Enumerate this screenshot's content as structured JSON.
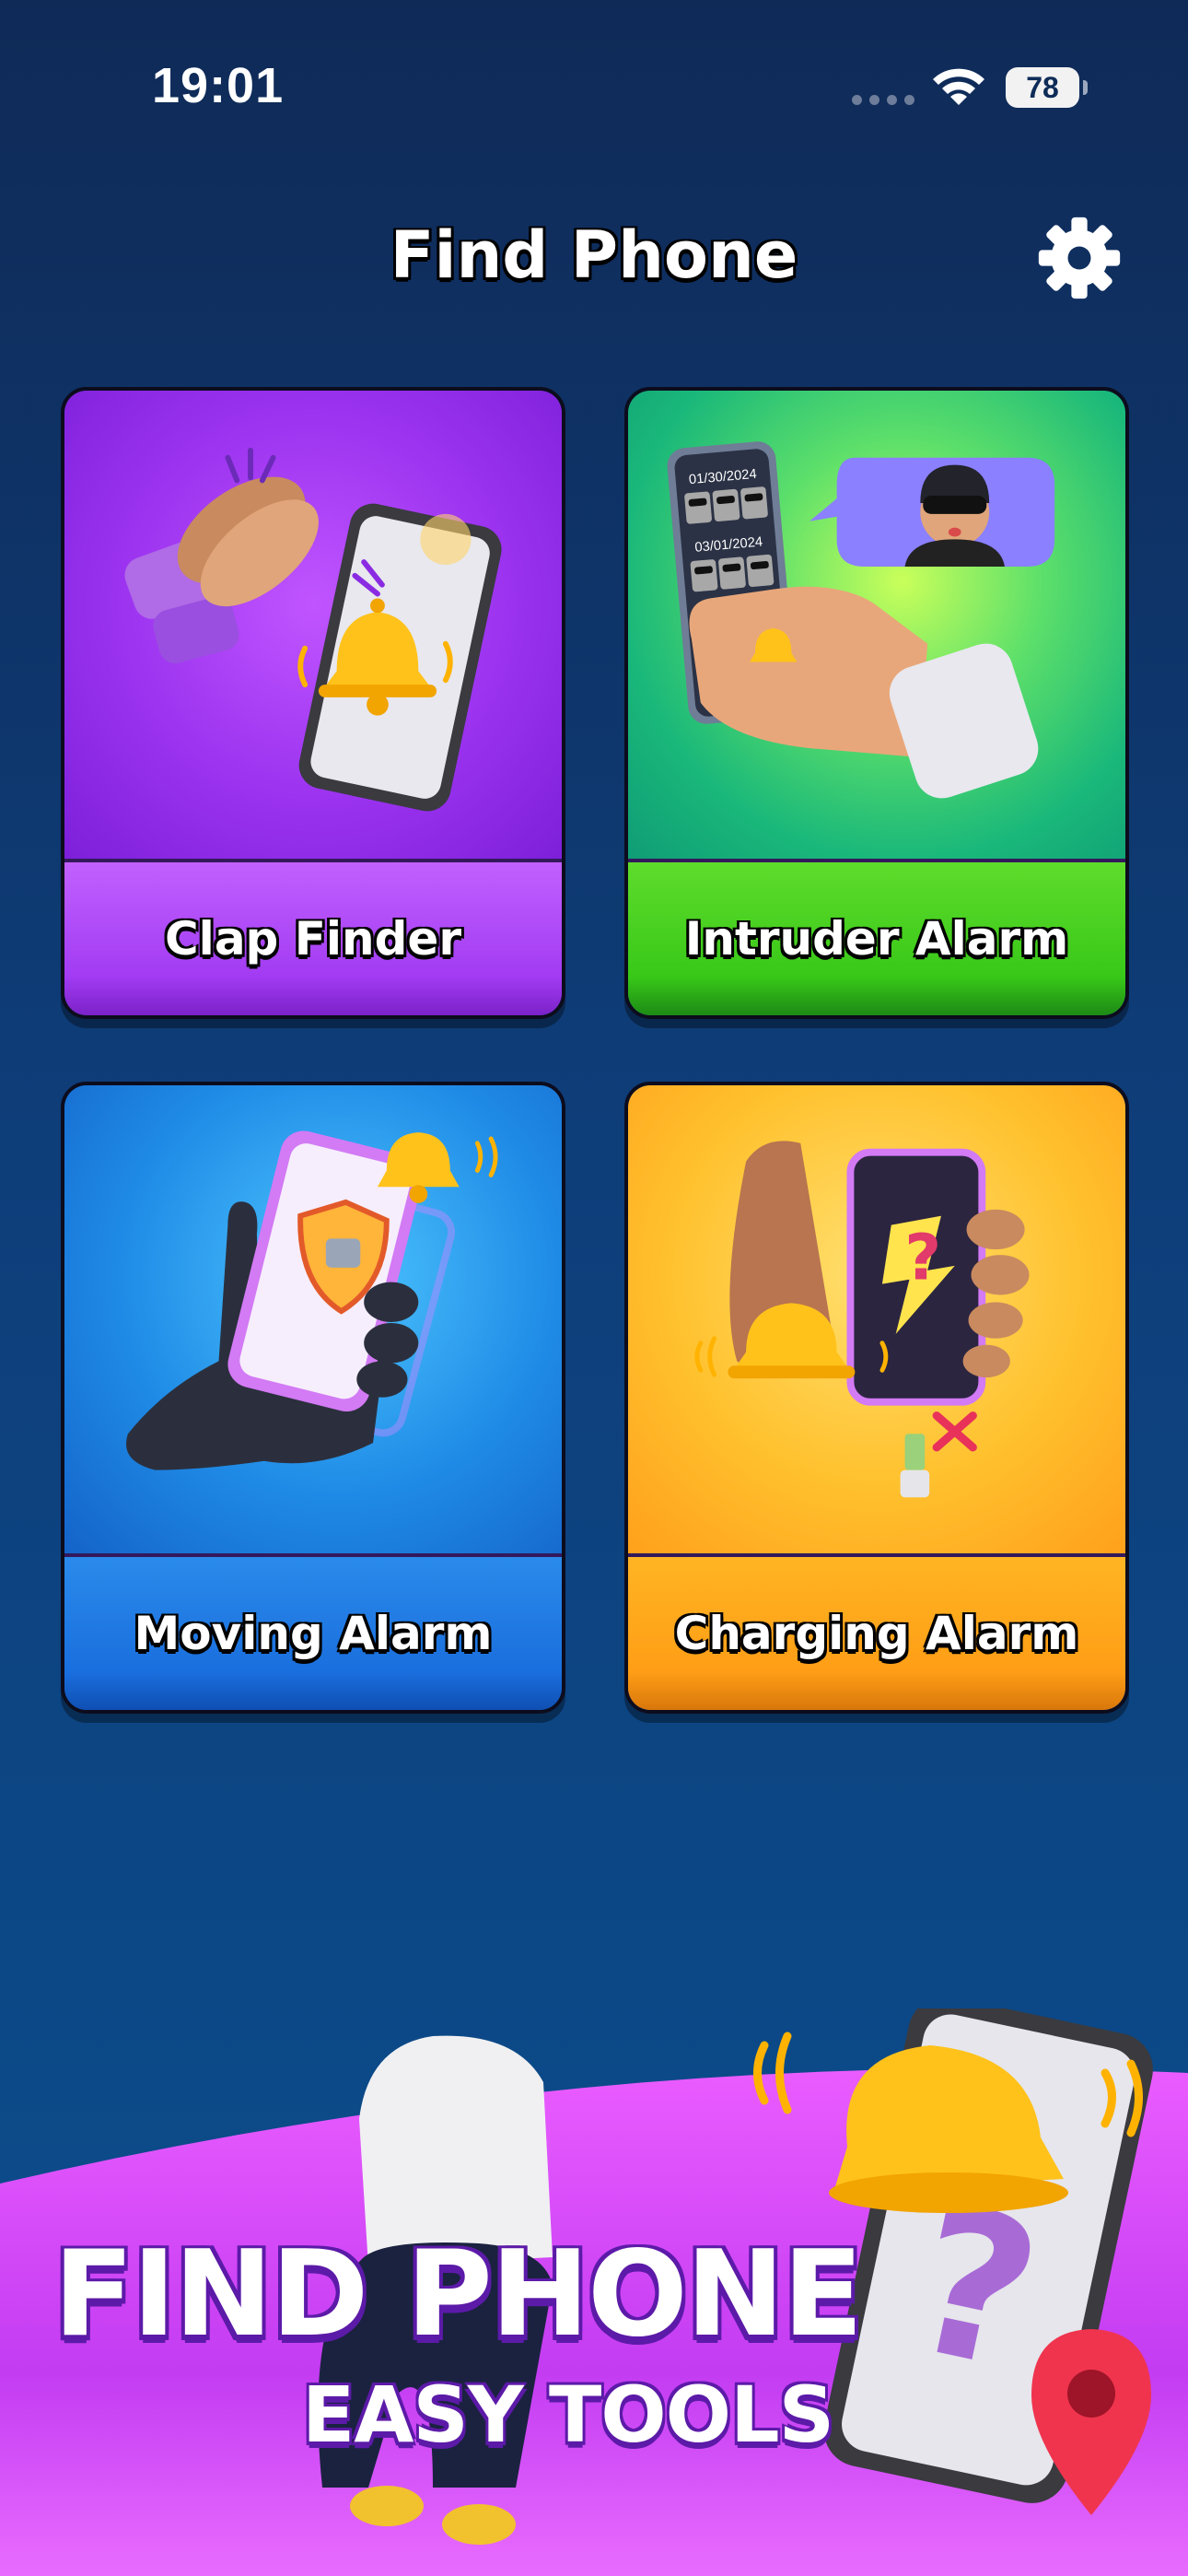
{
  "status_bar": {
    "time": "19:01",
    "battery": "78"
  },
  "header": {
    "title": "Find Phone"
  },
  "cards": [
    {
      "label": "Clap Finder",
      "illustration": "clap-phone-illustration"
    },
    {
      "label": "Intruder Alarm",
      "illustration": "intruder-phone-illustration",
      "photo_dates": [
        "01/30/2024",
        "03/01/2024"
      ]
    },
    {
      "label": "Moving Alarm",
      "illustration": "moving-phone-illustration"
    },
    {
      "label": "Charging Alarm",
      "illustration": "charging-phone-illustration"
    }
  ],
  "banner": {
    "line1": "FIND PHONE",
    "line2": "EASY TOOLS"
  },
  "colors": {
    "background": "#0e3e7a",
    "clap": "#a23bf2",
    "intruder": "#38c818",
    "moving": "#1a6fde",
    "charging": "#ff9e16",
    "banner": "#e24dff"
  }
}
